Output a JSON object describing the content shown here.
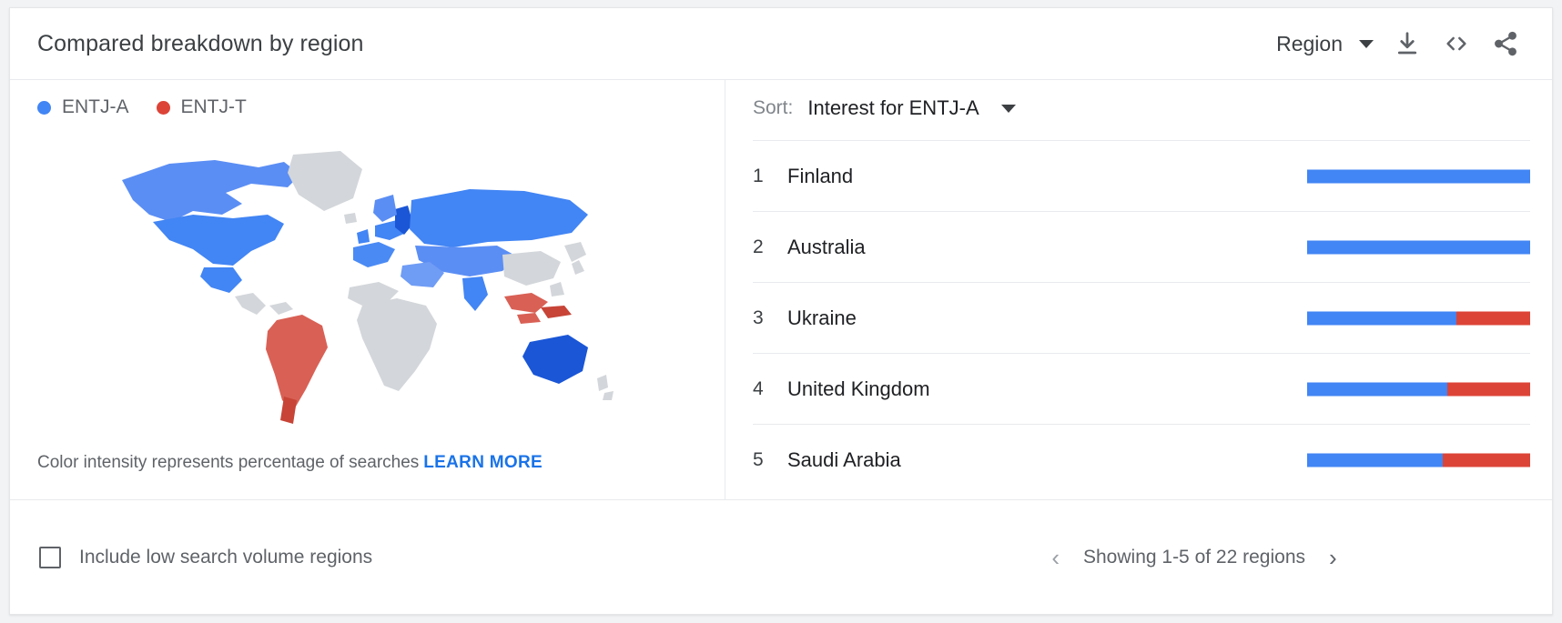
{
  "header": {
    "title": "Compared breakdown by region",
    "region_dropdown_label": "Region",
    "download_icon": "download-icon",
    "embed_icon": "embed-code-icon",
    "share_icon": "share-icon"
  },
  "legend": [
    {
      "label": "ENTJ-A",
      "color": "#4285f4"
    },
    {
      "label": "ENTJ-T",
      "color": "#dc4437"
    }
  ],
  "map": {
    "note_text": "Color intensity represents percentage of searches",
    "learn_more_label": "LEARN MORE"
  },
  "sort": {
    "label": "Sort:",
    "value": "Interest for ENTJ-A"
  },
  "footer": {
    "checkbox_label": "Include low search volume regions",
    "checkbox_checked": false,
    "prev_arrow": "chevron-left-icon",
    "next_arrow": "chevron-right-icon",
    "pagination_text": "Showing 1-5 of 22 regions"
  },
  "chart_data": {
    "type": "bar",
    "title": "Compared breakdown by region",
    "orientation": "horizontal",
    "stacked": true,
    "xlabel": "",
    "ylabel": "",
    "legend_position": "top-left",
    "grid": false,
    "series": [
      {
        "name": "ENTJ-A",
        "color": "#4285f4",
        "values": [
          100,
          100,
          67,
          63,
          61
        ]
      },
      {
        "name": "ENTJ-T",
        "color": "#dc4437",
        "values": [
          0,
          0,
          33,
          37,
          39
        ]
      }
    ],
    "categories": [
      "Finland",
      "Australia",
      "Ukraine",
      "United Kingdom",
      "Saudi Arabia"
    ],
    "ranks": [
      1,
      2,
      3,
      4,
      5
    ],
    "rows": [
      {
        "rank": "1",
        "region": "Finland",
        "a": 100,
        "b": 0
      },
      {
        "rank": "2",
        "region": "Australia",
        "a": 100,
        "b": 0
      },
      {
        "rank": "3",
        "region": "Ukraine",
        "a": 67,
        "b": 33
      },
      {
        "rank": "4",
        "region": "United Kingdom",
        "a": 63,
        "b": 37
      },
      {
        "rank": "5",
        "region": "Saudi Arabia",
        "a": 61,
        "b": 39
      }
    ]
  }
}
